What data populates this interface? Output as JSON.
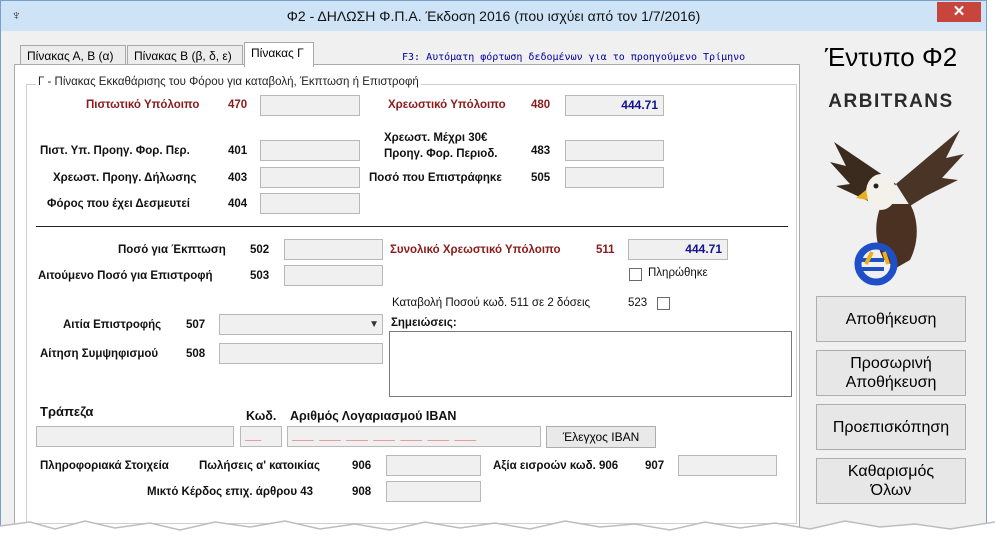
{
  "window": {
    "title": "Φ2 - ΔΗΛΩΣΗ Φ.Π.Α. Έκδοση 2016 (που ισχύει από τον 1/7/2016)",
    "close_glyph": "✕"
  },
  "tabs": [
    {
      "label": "Πίνακας Α, Β (α)",
      "active": false
    },
    {
      "label": "Πίνακας Β (β, δ, ε)",
      "active": false
    },
    {
      "label": "Πίνακας Γ",
      "active": true
    }
  ],
  "f3_hint": "F3: Αυτόματη φόρτωση δεδομένων για το προηγούμενο Τρίμηνο",
  "group_title": "Γ - Πίνακας Εκκαθάρισης του Φόρου για καταβολή, Έκπτωση ή Επιστροφή",
  "fields": {
    "f470": {
      "label": "Πιστωτικό Υπόλοιπο",
      "code": "470",
      "value": ""
    },
    "f480": {
      "label": "Χρεωστικό Υπόλοιπο",
      "code": "480",
      "value": "444.71"
    },
    "f401": {
      "label": "Πιστ. Υπ. Προηγ. Φορ. Περ.",
      "code": "401",
      "value": ""
    },
    "f483": {
      "label_line1": "Χρεωστ. Μέχρι 30€",
      "label_line2": "Προηγ. Φορ. Περιοδ.",
      "code": "483",
      "value": ""
    },
    "f403": {
      "label": "Χρεωστ. Προηγ. Δήλωσης",
      "code": "403",
      "value": ""
    },
    "f505": {
      "label": "Ποσό που Επιστράφηκε",
      "code": "505",
      "value": ""
    },
    "f404": {
      "label": "Φόρος που έχει Δεσμευτεί",
      "code": "404",
      "value": ""
    },
    "f502": {
      "label": "Ποσό για Έκπτωση",
      "code": "502",
      "value": ""
    },
    "f511": {
      "label": "Συνολικό Χρεωστικό Υπόλοιπο",
      "code": "511",
      "value": "444.71"
    },
    "f503": {
      "label": "Αιτούμενο Ποσό για Επιστροφή",
      "code": "503",
      "value": ""
    },
    "f507": {
      "label": "Αιτία Επιστροφής",
      "code": "507",
      "value": ""
    },
    "f508": {
      "label": "Αίτηση Συμψηφισμού",
      "code": "508",
      "value": ""
    },
    "f906": {
      "label": "Πωλήσεις α' κατοικίας",
      "code": "906",
      "value": ""
    },
    "f907": {
      "label": "Αξία εισροών κωδ. 906",
      "code": "907",
      "value": ""
    },
    "f908": {
      "label": "Μικτό Κέρδος επιχ. άρθρου 43",
      "code": "908",
      "value": ""
    }
  },
  "paid_label": "Πληρώθηκε",
  "installments": {
    "label": "Καταβολή Ποσού κωδ. 511 σε 2 δόσεις",
    "code": "523"
  },
  "notes_label": "Σημειώσεις:",
  "bank": {
    "bank_label": "Τράπεζα",
    "code_label": "Κωδ.",
    "iban_label": "Αριθμός Λογαριασμού IBAN",
    "code_mask": "___",
    "iban_mask": "____ ____ ____ ____ ____ ____ ____",
    "check_button": "Έλεγχος IBAN"
  },
  "info_label": "Πληροφοριακά Στοιχεία",
  "sidebar": {
    "form_title": "Έντυπο Φ2",
    "brand": "ARBITRANS",
    "buttons": [
      {
        "label": "Αποθήκευση"
      },
      {
        "label": "Προσωρινή Αποθήκευση"
      },
      {
        "label": "Προεπισκόπηση"
      },
      {
        "label": "Καθαρισμός Όλων"
      }
    ]
  },
  "colors": {
    "accent_dark_red": "#8b1a1a",
    "value_blue": "#12128c",
    "hint_blue": "#0000a0",
    "mask_red": "#d00000",
    "titlebar": "#cfe3f7",
    "close": "#c7453c"
  }
}
